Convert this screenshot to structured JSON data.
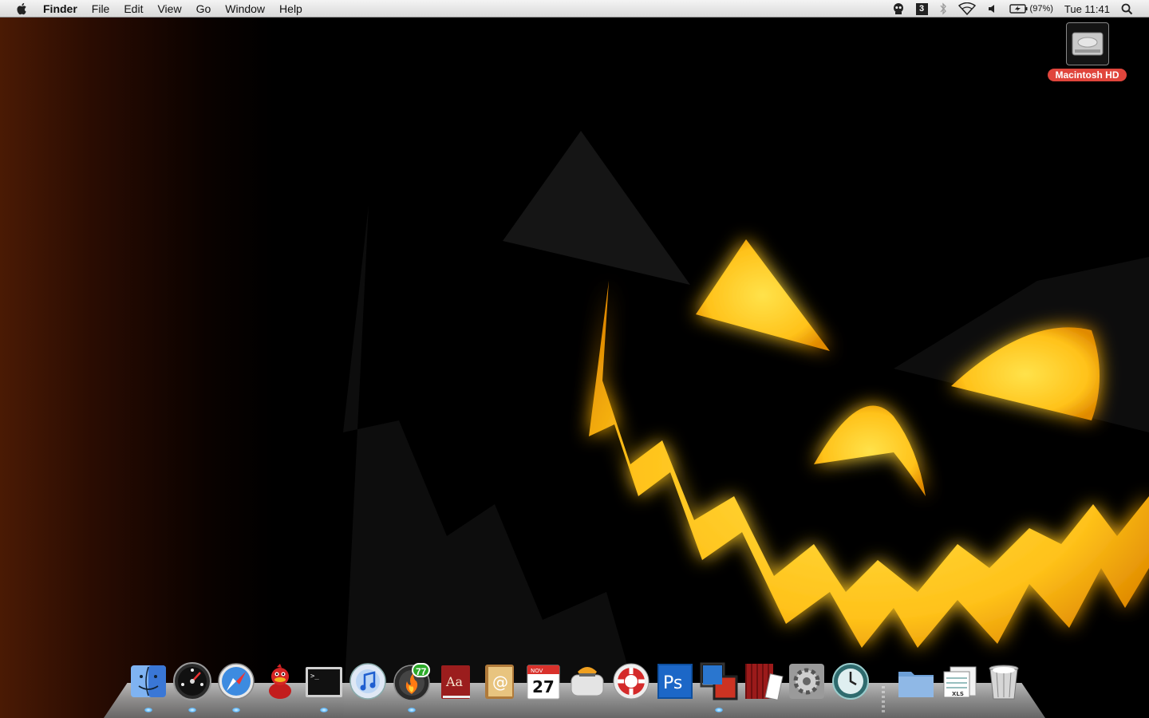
{
  "menubar": {
    "app_name": "Finder",
    "menus": [
      "File",
      "Edit",
      "View",
      "Go",
      "Window",
      "Help"
    ],
    "status": {
      "spaces_number": "3",
      "battery_percent": "(97%)",
      "clock": "Tue 11:41"
    }
  },
  "desktop": {
    "icons": [
      {
        "label": "Macintosh HD",
        "icon": "hard-drive-icon"
      }
    ]
  },
  "dock": {
    "apps": [
      {
        "name": "finder",
        "icon": "finder-icon"
      },
      {
        "name": "dashboard",
        "icon": "dashboard-icon"
      },
      {
        "name": "safari",
        "icon": "safari-icon"
      },
      {
        "name": "adium",
        "icon": "duck-icon"
      },
      {
        "name": "terminal",
        "icon": "terminal-icon"
      },
      {
        "name": "itunes",
        "icon": "itunes-icon"
      },
      {
        "name": "burn",
        "icon": "flame-icon",
        "badge": "77"
      },
      {
        "name": "dictionary",
        "icon": "dictionary-icon"
      },
      {
        "name": "address-book",
        "icon": "address-book-icon"
      },
      {
        "name": "ical",
        "icon": "calendar-icon",
        "month": "NOV",
        "day": "27"
      },
      {
        "name": "toaster",
        "icon": "toaster-icon"
      },
      {
        "name": "network-app",
        "icon": "lifebuoy-icon"
      },
      {
        "name": "photoshop",
        "icon": "photoshop-icon",
        "text": "Ps"
      },
      {
        "name": "vmware",
        "icon": "vmware-icon"
      },
      {
        "name": "photo-booth",
        "icon": "photo-booth-icon"
      },
      {
        "name": "system-preferences",
        "icon": "gear-icon"
      },
      {
        "name": "time-machine",
        "icon": "time-machine-icon"
      }
    ],
    "docs": [
      {
        "name": "documents",
        "icon": "folder-icon"
      },
      {
        "name": "downloads",
        "icon": "spreadsheet-stack-icon",
        "text": "XLS"
      },
      {
        "name": "trash",
        "icon": "trash-icon"
      }
    ]
  },
  "colors": {
    "menubar_top": "#f4f4f4",
    "wallpaper_glow": "#ffd21a",
    "hd_label_bg": "#e0453c",
    "badge_green": "#2daa2a"
  }
}
